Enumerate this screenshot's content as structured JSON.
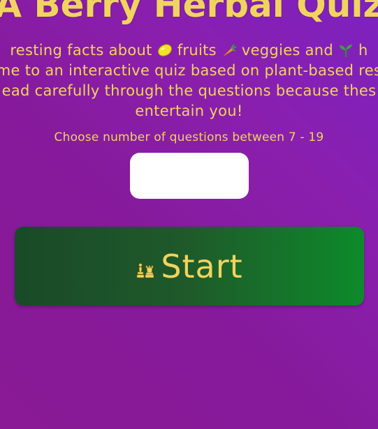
{
  "title": "A Berry Herbal Quiz",
  "intro": {
    "line1_a": "resting facts about",
    "line1_b": "fruits",
    "line1_c": "veggies and",
    "line1_d": "h",
    "line2": "me to an interactive quiz based on plant-based res",
    "line3": "ead carefully through the questions because thes",
    "line4": "entertain you!"
  },
  "icons": {
    "lemon": "lemon-icon",
    "carrot": "carrot-icon",
    "seedling": "seedling-icon",
    "chess": "chess-pieces-icon"
  },
  "prompt": "Choose number of questions between 7 - 19",
  "question_input": {
    "value": "",
    "placeholder": ""
  },
  "start_button": {
    "label": "Start"
  },
  "colors": {
    "text": "#f0d45e",
    "button_green": "#1f5a2a",
    "background_purple": "#8a1fae"
  }
}
